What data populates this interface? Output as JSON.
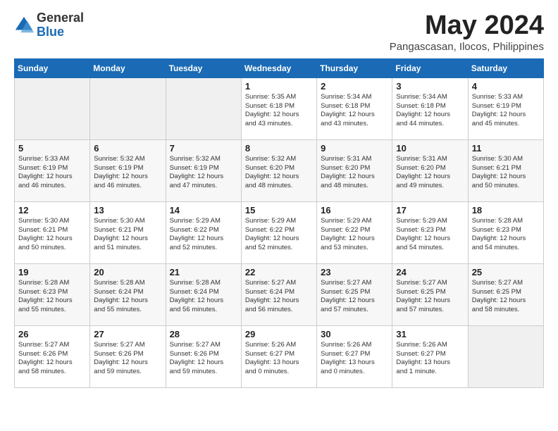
{
  "logo": {
    "general": "General",
    "blue": "Blue"
  },
  "title": "May 2024",
  "location": "Pangascasan, Ilocos, Philippines",
  "days_of_week": [
    "Sunday",
    "Monday",
    "Tuesday",
    "Wednesday",
    "Thursday",
    "Friday",
    "Saturday"
  ],
  "weeks": [
    [
      {
        "day": "",
        "info": ""
      },
      {
        "day": "",
        "info": ""
      },
      {
        "day": "",
        "info": ""
      },
      {
        "day": "1",
        "info": "Sunrise: 5:35 AM\nSunset: 6:18 PM\nDaylight: 12 hours\nand 43 minutes."
      },
      {
        "day": "2",
        "info": "Sunrise: 5:34 AM\nSunset: 6:18 PM\nDaylight: 12 hours\nand 43 minutes."
      },
      {
        "day": "3",
        "info": "Sunrise: 5:34 AM\nSunset: 6:18 PM\nDaylight: 12 hours\nand 44 minutes."
      },
      {
        "day": "4",
        "info": "Sunrise: 5:33 AM\nSunset: 6:19 PM\nDaylight: 12 hours\nand 45 minutes."
      }
    ],
    [
      {
        "day": "5",
        "info": "Sunrise: 5:33 AM\nSunset: 6:19 PM\nDaylight: 12 hours\nand 46 minutes."
      },
      {
        "day": "6",
        "info": "Sunrise: 5:32 AM\nSunset: 6:19 PM\nDaylight: 12 hours\nand 46 minutes."
      },
      {
        "day": "7",
        "info": "Sunrise: 5:32 AM\nSunset: 6:19 PM\nDaylight: 12 hours\nand 47 minutes."
      },
      {
        "day": "8",
        "info": "Sunrise: 5:32 AM\nSunset: 6:20 PM\nDaylight: 12 hours\nand 48 minutes."
      },
      {
        "day": "9",
        "info": "Sunrise: 5:31 AM\nSunset: 6:20 PM\nDaylight: 12 hours\nand 48 minutes."
      },
      {
        "day": "10",
        "info": "Sunrise: 5:31 AM\nSunset: 6:20 PM\nDaylight: 12 hours\nand 49 minutes."
      },
      {
        "day": "11",
        "info": "Sunrise: 5:30 AM\nSunset: 6:21 PM\nDaylight: 12 hours\nand 50 minutes."
      }
    ],
    [
      {
        "day": "12",
        "info": "Sunrise: 5:30 AM\nSunset: 6:21 PM\nDaylight: 12 hours\nand 50 minutes."
      },
      {
        "day": "13",
        "info": "Sunrise: 5:30 AM\nSunset: 6:21 PM\nDaylight: 12 hours\nand 51 minutes."
      },
      {
        "day": "14",
        "info": "Sunrise: 5:29 AM\nSunset: 6:22 PM\nDaylight: 12 hours\nand 52 minutes."
      },
      {
        "day": "15",
        "info": "Sunrise: 5:29 AM\nSunset: 6:22 PM\nDaylight: 12 hours\nand 52 minutes."
      },
      {
        "day": "16",
        "info": "Sunrise: 5:29 AM\nSunset: 6:22 PM\nDaylight: 12 hours\nand 53 minutes."
      },
      {
        "day": "17",
        "info": "Sunrise: 5:29 AM\nSunset: 6:23 PM\nDaylight: 12 hours\nand 54 minutes."
      },
      {
        "day": "18",
        "info": "Sunrise: 5:28 AM\nSunset: 6:23 PM\nDaylight: 12 hours\nand 54 minutes."
      }
    ],
    [
      {
        "day": "19",
        "info": "Sunrise: 5:28 AM\nSunset: 6:23 PM\nDaylight: 12 hours\nand 55 minutes."
      },
      {
        "day": "20",
        "info": "Sunrise: 5:28 AM\nSunset: 6:24 PM\nDaylight: 12 hours\nand 55 minutes."
      },
      {
        "day": "21",
        "info": "Sunrise: 5:28 AM\nSunset: 6:24 PM\nDaylight: 12 hours\nand 56 minutes."
      },
      {
        "day": "22",
        "info": "Sunrise: 5:27 AM\nSunset: 6:24 PM\nDaylight: 12 hours\nand 56 minutes."
      },
      {
        "day": "23",
        "info": "Sunrise: 5:27 AM\nSunset: 6:25 PM\nDaylight: 12 hours\nand 57 minutes."
      },
      {
        "day": "24",
        "info": "Sunrise: 5:27 AM\nSunset: 6:25 PM\nDaylight: 12 hours\nand 57 minutes."
      },
      {
        "day": "25",
        "info": "Sunrise: 5:27 AM\nSunset: 6:25 PM\nDaylight: 12 hours\nand 58 minutes."
      }
    ],
    [
      {
        "day": "26",
        "info": "Sunrise: 5:27 AM\nSunset: 6:26 PM\nDaylight: 12 hours\nand 58 minutes."
      },
      {
        "day": "27",
        "info": "Sunrise: 5:27 AM\nSunset: 6:26 PM\nDaylight: 12 hours\nand 59 minutes."
      },
      {
        "day": "28",
        "info": "Sunrise: 5:27 AM\nSunset: 6:26 PM\nDaylight: 12 hours\nand 59 minutes."
      },
      {
        "day": "29",
        "info": "Sunrise: 5:26 AM\nSunset: 6:27 PM\nDaylight: 13 hours\nand 0 minutes."
      },
      {
        "day": "30",
        "info": "Sunrise: 5:26 AM\nSunset: 6:27 PM\nDaylight: 13 hours\nand 0 minutes."
      },
      {
        "day": "31",
        "info": "Sunrise: 5:26 AM\nSunset: 6:27 PM\nDaylight: 13 hours\nand 1 minute."
      },
      {
        "day": "",
        "info": ""
      }
    ]
  ]
}
